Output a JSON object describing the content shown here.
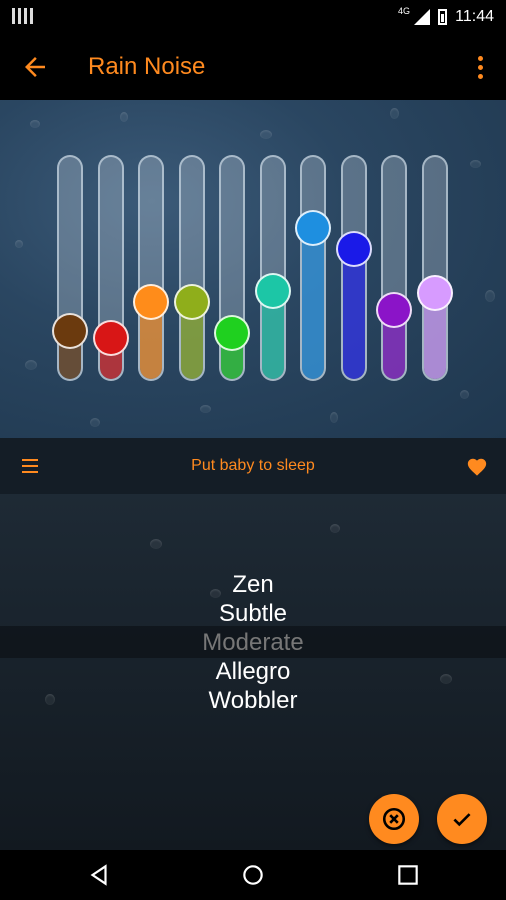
{
  "status": {
    "time": "11:44",
    "network": "4G"
  },
  "app_bar": {
    "title": "Rain Noise"
  },
  "equalizer": {
    "sliders": [
      {
        "color": "#6b3a0e",
        "level": 0.17
      },
      {
        "color": "#d81616",
        "level": 0.13
      },
      {
        "color": "#ff8c1a",
        "level": 0.32
      },
      {
        "color": "#8fae1b",
        "level": 0.32
      },
      {
        "color": "#1fd01f",
        "level": 0.16
      },
      {
        "color": "#1cc6a6",
        "level": 0.38
      },
      {
        "color": "#1e8fe0",
        "level": 0.71
      },
      {
        "color": "#1a1ae8",
        "level": 0.6
      },
      {
        "color": "#8b14c8",
        "level": 0.28
      },
      {
        "color": "#d79bff",
        "level": 0.37
      }
    ]
  },
  "preset": {
    "name": "Put baby to sleep"
  },
  "picker": {
    "items": [
      "Zen",
      "Subtle",
      "Moderate",
      "Allegro",
      "Wobbler"
    ],
    "selected": "Moderate"
  },
  "icons": {
    "back": "back-arrow-icon",
    "more": "more-vert-icon",
    "menu": "menu-icon",
    "favorite": "heart-icon",
    "cancel": "cancel-icon",
    "confirm": "check-icon"
  },
  "accent": "#ff8a1f"
}
